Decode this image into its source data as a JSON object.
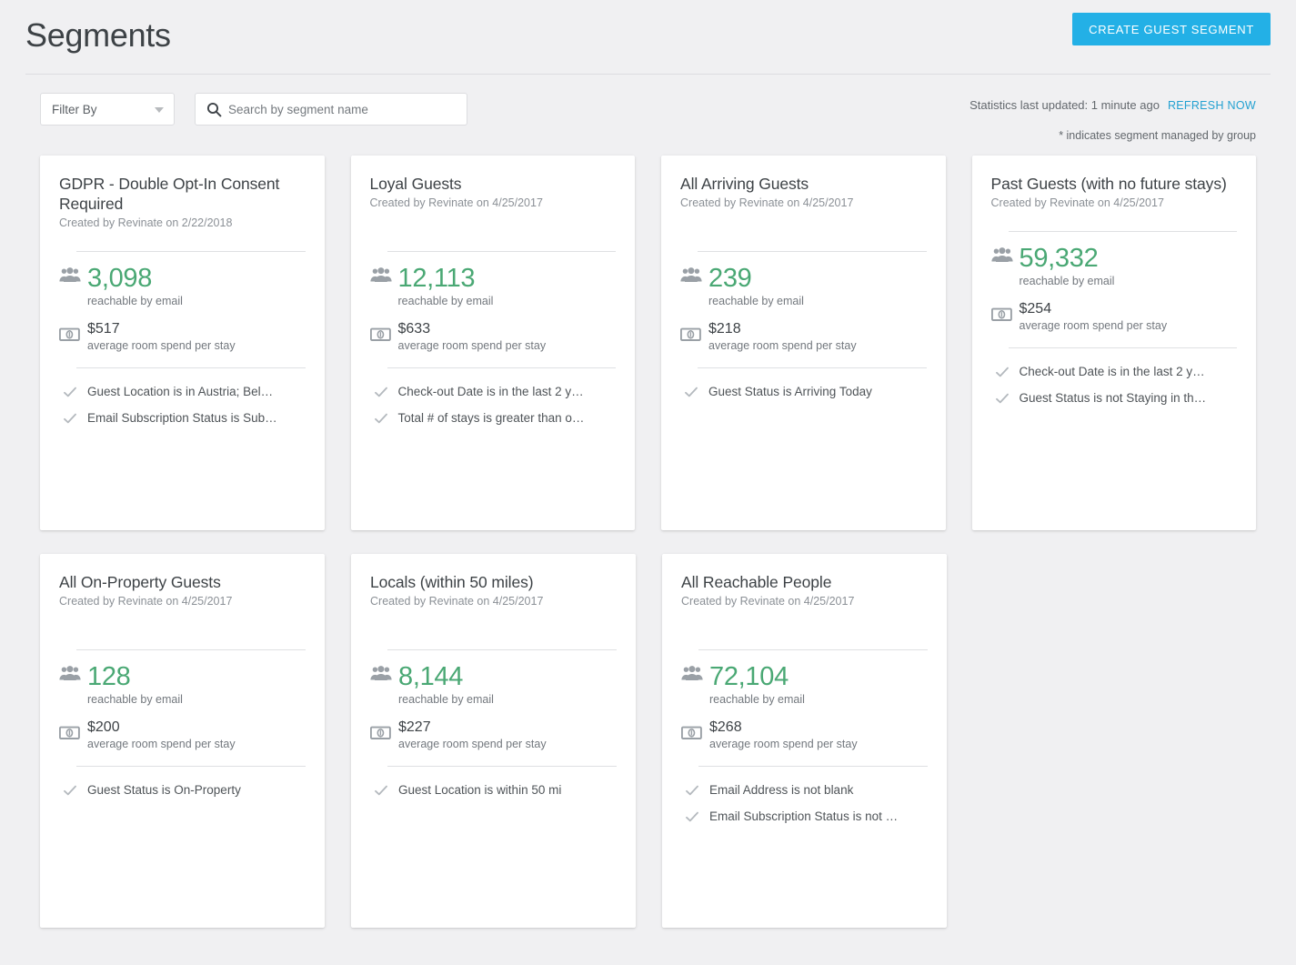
{
  "header": {
    "title": "Segments",
    "create_button": "CREATE GUEST SEGMENT"
  },
  "toolbar": {
    "filter_label": "Filter By",
    "search_placeholder": "Search by segment name",
    "search_value": "",
    "stats_text": "Statistics last updated: 1 minute ago",
    "refresh_label": "REFRESH NOW",
    "managed_note": "* indicates segment managed by group"
  },
  "colors": {
    "page_background": "#f0f0f2",
    "accent_blue": "#23b0e6",
    "link_blue": "#23a1d1",
    "metric_green": "#4aa874",
    "card_background": "#ffffff",
    "divider": "#dcdde0"
  },
  "labels": {
    "reachable": "reachable by email",
    "avg_spend": "average room spend per stay"
  },
  "cards": [
    {
      "title": "GDPR - Double Opt-In Consent Required",
      "subtitle": "Created by Revinate on 2/22/2018",
      "count": "3,098",
      "count_label": "reachable by email",
      "spend": "$517",
      "spend_label": "average room spend per stay",
      "criteria": [
        "Guest Location is in Austria; Bel…",
        "Email Subscription Status is Sub…"
      ]
    },
    {
      "title": "Loyal Guests",
      "subtitle": "Created by Revinate on 4/25/2017",
      "count": "12,113",
      "count_label": "reachable by email",
      "spend": "$633",
      "spend_label": "average room spend per stay",
      "criteria": [
        "Check-out Date is in the last 2 y…",
        "Total # of stays is greater than o…"
      ]
    },
    {
      "title": "All Arriving Guests",
      "subtitle": "Created by Revinate on 4/25/2017",
      "count": "239",
      "count_label": "reachable by email",
      "spend": "$218",
      "spend_label": "average room spend per stay",
      "criteria": [
        "Guest Status is Arriving Today"
      ]
    },
    {
      "title": "Past Guests (with no future stays)",
      "subtitle": "Created by Revinate on 4/25/2017",
      "count": "59,332",
      "count_label": "reachable by email",
      "spend": "$254",
      "spend_label": "average room spend per stay",
      "criteria": [
        "Check-out Date is in the last 2 y…",
        "Guest Status is not Staying in th…"
      ]
    },
    {
      "title": "All On-Property Guests",
      "subtitle": "Created by Revinate on 4/25/2017",
      "count": "128",
      "count_label": "reachable by email",
      "spend": "$200",
      "spend_label": "average room spend per stay",
      "criteria": [
        "Guest Status is On-Property"
      ]
    },
    {
      "title": "Locals (within 50 miles)",
      "subtitle": "Created by Revinate on 4/25/2017",
      "count": "8,144",
      "count_label": "reachable by email",
      "spend": "$227",
      "spend_label": "average room spend per stay",
      "criteria": [
        "Guest Location is within 50 mi"
      ]
    },
    {
      "title": "All Reachable People",
      "subtitle": "Created by Revinate on 4/25/2017",
      "count": "72,104",
      "count_label": "reachable by email",
      "spend": "$268",
      "spend_label": "average room spend per stay",
      "criteria": [
        "Email Address is not blank",
        "Email Subscription Status is not …"
      ]
    }
  ],
  "icons": {
    "people": "people-group-icon",
    "money": "banknote-icon",
    "check": "checkmark-icon",
    "search": "search-icon",
    "caret": "chevron-down-icon"
  }
}
